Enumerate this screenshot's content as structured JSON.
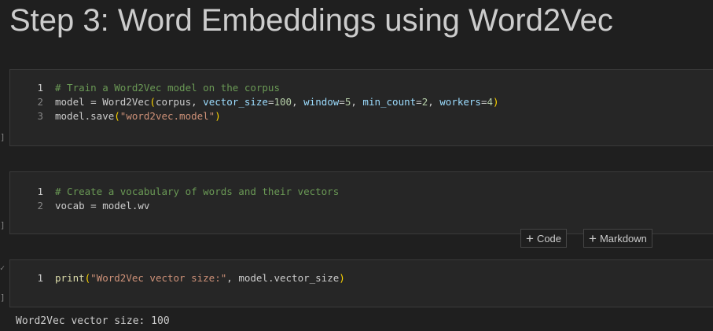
{
  "title": "Step 3: Word Embeddings using Word2Vec",
  "cells": [
    {
      "lines": [
        [
          {
            "t": "comment",
            "v": "# Train a Word2Vec model on the corpus"
          }
        ],
        [
          {
            "t": "plain",
            "v": "model = Word2Vec"
          },
          {
            "t": "paren",
            "v": "("
          },
          {
            "t": "plain",
            "v": "corpus, "
          },
          {
            "t": "var",
            "v": "vector_size"
          },
          {
            "t": "plain",
            "v": "="
          },
          {
            "t": "num",
            "v": "100"
          },
          {
            "t": "plain",
            "v": ", "
          },
          {
            "t": "var",
            "v": "window"
          },
          {
            "t": "plain",
            "v": "="
          },
          {
            "t": "num",
            "v": "5"
          },
          {
            "t": "plain",
            "v": ", "
          },
          {
            "t": "var",
            "v": "min_count"
          },
          {
            "t": "plain",
            "v": "="
          },
          {
            "t": "num",
            "v": "2"
          },
          {
            "t": "plain",
            "v": ", "
          },
          {
            "t": "var",
            "v": "workers"
          },
          {
            "t": "plain",
            "v": "="
          },
          {
            "t": "num",
            "v": "4"
          },
          {
            "t": "paren",
            "v": ")"
          }
        ],
        [
          {
            "t": "plain",
            "v": "model.save"
          },
          {
            "t": "paren",
            "v": "("
          },
          {
            "t": "str",
            "v": "\"word2vec.model\""
          },
          {
            "t": "paren",
            "v": ")"
          }
        ]
      ]
    },
    {
      "lines": [
        [
          {
            "t": "comment",
            "v": "# Create a vocabulary of words and their vectors"
          }
        ],
        [
          {
            "t": "plain",
            "v": "vocab = model.wv"
          }
        ]
      ]
    },
    {
      "lines": [
        [
          {
            "t": "fn",
            "v": "print"
          },
          {
            "t": "paren",
            "v": "("
          },
          {
            "t": "str",
            "v": "\"Word2Vec vector size:\""
          },
          {
            "t": "plain",
            "v": ", model.vector_size"
          },
          {
            "t": "paren",
            "v": ")"
          }
        ]
      ],
      "output": "Word2Vec vector size: 100"
    }
  ],
  "add_cell": {
    "code_label": "Code",
    "markdown_label": "Markdown"
  },
  "icons": {
    "add": "plus-icon",
    "collapse": "chevron-down-icon"
  }
}
